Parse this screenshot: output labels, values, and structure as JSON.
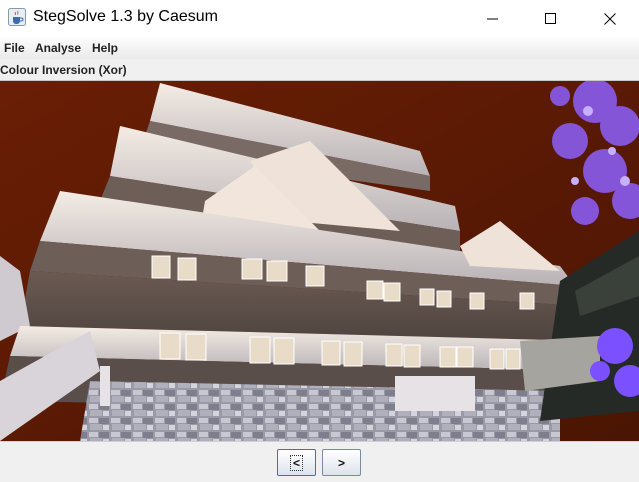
{
  "window": {
    "title": "StegSolve 1.3 by Caesum",
    "app_icon": "java-cup-icon",
    "controls": [
      "minimize-icon",
      "maximize-icon",
      "close-icon"
    ]
  },
  "menu": {
    "items": [
      {
        "label": "File"
      },
      {
        "label": "Analyse"
      },
      {
        "label": "Help"
      }
    ]
  },
  "view": {
    "mode_label": "Colour Inversion (Xor)"
  },
  "nav": {
    "prev_label": "<",
    "next_label": ">"
  },
  "colors": {
    "sky": "#5a1b06",
    "foliage": "#8a5cf0",
    "wall": "#5f5048"
  }
}
